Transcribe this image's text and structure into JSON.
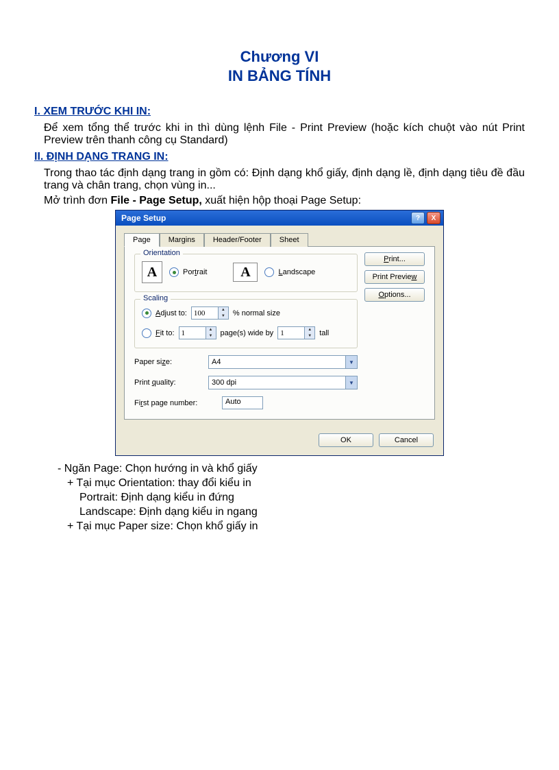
{
  "doc": {
    "chapter": "Chương VI",
    "title": "IN BẢNG TÍNH",
    "h1": "I. XEM TRƯỚC KHI IN:",
    "p1": "Để xem tổng thể trước khi in thì dùng lệnh File - Print Preview (hoặc kích chuột vào nút Print Preview  trên thanh công cụ Standard)",
    "h2": "II. ĐỊNH DẠNG TRANG IN:",
    "p2": "Trong thao tác định dạng trang in gồm có: Định dạng khổ giấy, định dạng lề, định dạng tiêu đề đầu trang và chân trang, chọn vùng in...",
    "p3_a": "Mở trình đơn ",
    "p3_b": "File - Page Setup,",
    "p3_c": " xuất hiện hộp thoại Page Setup:",
    "b1": "- Ngăn Page: Chọn hướng in và khổ giấy",
    "b2": "+ Tại mục Orientation: thay đổi kiểu in",
    "b3": "Portrait: Định dạng kiểu in đứng",
    "b4": "Landscape: Định dạng kiểu in ngang",
    "b5": "+ Tại mục Paper size: Chọn khổ giấy in"
  },
  "dialog": {
    "title": "Page Setup",
    "help": "?",
    "close": "X",
    "tabs": {
      "page": "Page",
      "margins": "Margins",
      "headerfooter": "Header/Footer",
      "sheet": "Sheet"
    },
    "orientation": {
      "legend": "Orientation",
      "iconA": "A",
      "portrait": "Portrait",
      "landscape": "Landscape"
    },
    "scaling": {
      "legend": "Scaling",
      "adjust_label_a": "A",
      "adjust_label_b": "djust to:",
      "adjust_value": "100",
      "adjust_suffix": "% normal size",
      "fit_label_a": "F",
      "fit_label_b": "it to:",
      "fit_wide": "1",
      "fit_mid": "page(s) wide by",
      "fit_tall": "1",
      "fit_suffix": "tall"
    },
    "paper": {
      "size_label_a": "Paper si",
      "size_label_z": "z",
      "size_label_b": "e:",
      "size_value": "A4",
      "quality_label_a": "Print ",
      "quality_label_q": "q",
      "quality_label_b": "uality:",
      "quality_value": "300 dpi",
      "firstpage_label_a": "Fi",
      "firstpage_label_r": "r",
      "firstpage_label_b": "st page number:",
      "firstpage_value": "Auto"
    },
    "buttons": {
      "print": "Print...",
      "preview": "Print Preview",
      "options": "Options...",
      "ok": "OK",
      "cancel": "Cancel"
    }
  }
}
